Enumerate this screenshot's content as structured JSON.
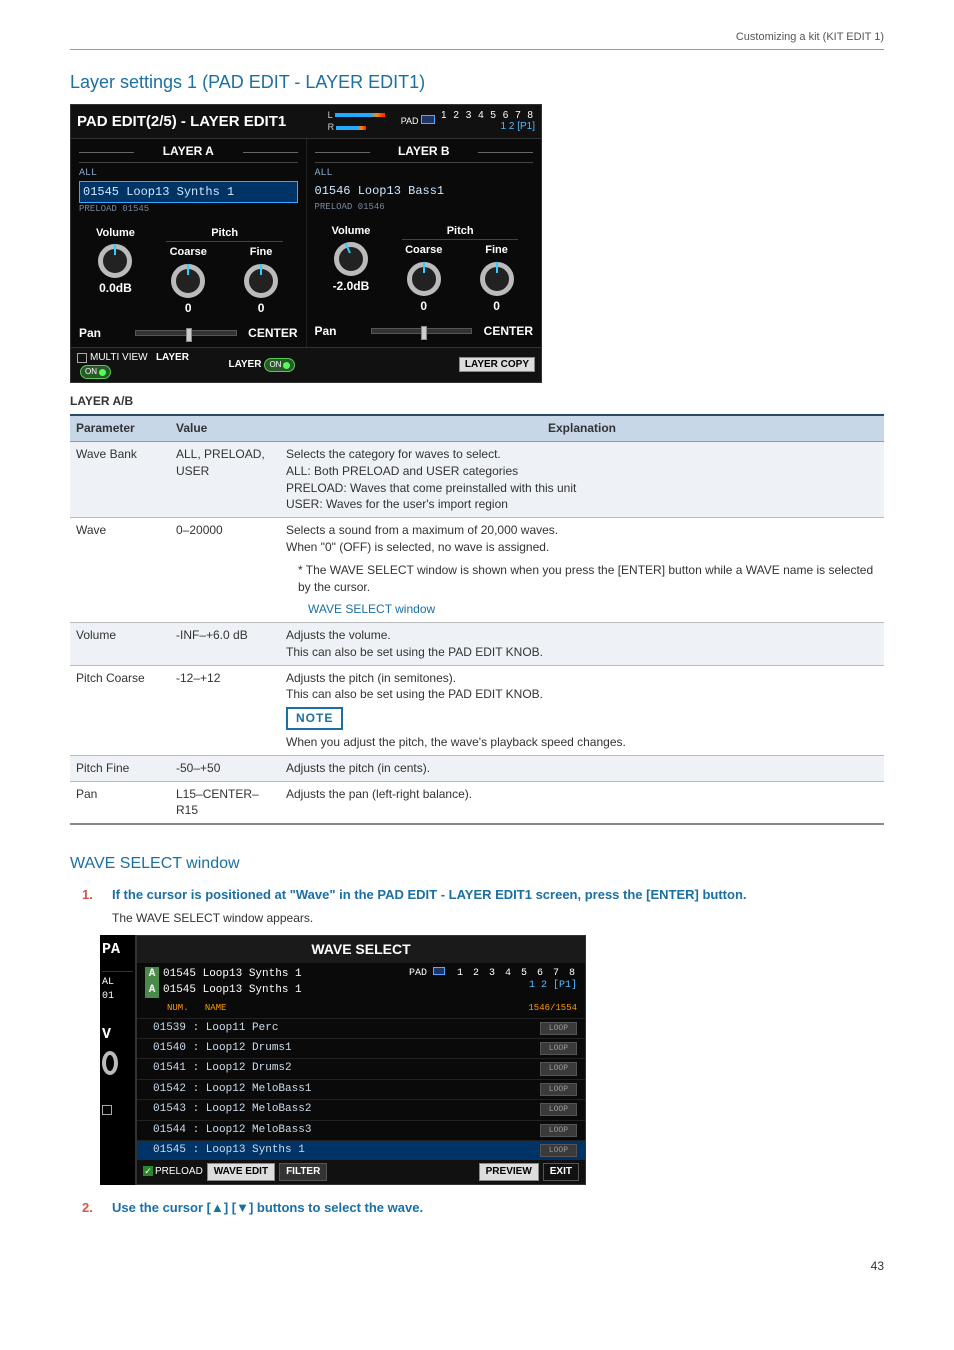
{
  "header": {
    "breadcrumb": "Customizing a kit (KIT EDIT 1)"
  },
  "section1_title": "Layer settings 1 (PAD EDIT - LAYER EDIT1)",
  "pad_edit_screen": {
    "title": "PAD EDIT(2/5) - LAYER EDIT1",
    "meters": {
      "L": "L",
      "R": "R"
    },
    "pad_label": "PAD",
    "pad_numbers": "1 2 3 4 5 6 7 8",
    "pad_sub": "1 2 [P1]",
    "layer_a": {
      "title": "LAYER A",
      "bank": "ALL",
      "wave": "01545 Loop13 Synths 1",
      "preload": "PRELOAD 01545",
      "volume_label": "Volume",
      "volume_val": "0.0dB",
      "pitch_label": "Pitch",
      "coarse_label": "Coarse",
      "coarse_val": "0",
      "fine_label": "Fine",
      "fine_val": "0",
      "pan_label": "Pan",
      "pan_val": "CENTER",
      "layer_on": "ON"
    },
    "layer_b": {
      "title": "LAYER B",
      "bank": "ALL",
      "wave": "01546 Loop13 Bass1",
      "preload": "PRELOAD 01546",
      "volume_label": "Volume",
      "volume_val": "-2.0dB",
      "pitch_label": "Pitch",
      "coarse_label": "Coarse",
      "coarse_val": "0",
      "fine_label": "Fine",
      "fine_val": "0",
      "pan_label": "Pan",
      "pan_val": "CENTER",
      "layer_on": "ON"
    },
    "footer": {
      "multi_view": "MULTI VIEW",
      "layer": "LAYER",
      "layer_copy": "LAYER COPY"
    }
  },
  "layer_ab_heading": "LAYER A/B",
  "table": {
    "headers": {
      "param": "Parameter",
      "value": "Value",
      "expl": "Explanation"
    },
    "rows": [
      {
        "param": "Wave Bank",
        "value": "ALL, PRELOAD, USER",
        "expl_lines": [
          "Selects the category for waves to select.",
          "ALL: Both PRELOAD and USER categories",
          "PRELOAD: Waves that come preinstalled with this unit",
          "USER: Waves for the user's import region"
        ]
      },
      {
        "param": "Wave",
        "value": "0–20000",
        "expl_lines": [
          "Selects a sound from a maximum of 20,000 waves.",
          "When \"0\" (OFF) is selected, no wave is assigned."
        ],
        "bullet": "The WAVE SELECT window is shown when you press the [ENTER] button while a WAVE name is selected by the cursor.",
        "link": "WAVE SELECT window"
      },
      {
        "param": "Volume",
        "value": "-INF–+6.0 dB",
        "expl_lines": [
          "Adjusts the volume.",
          "This can also be set using the PAD EDIT KNOB."
        ]
      },
      {
        "param": "Pitch Coarse",
        "value": "-12–+12",
        "expl_lines": [
          "Adjusts the pitch (in semitones).",
          "This can also be set using the PAD EDIT KNOB."
        ],
        "note": "NOTE",
        "after_note": "When you adjust the pitch, the wave's playback speed changes."
      },
      {
        "param": "Pitch Fine",
        "value": "-50–+50",
        "expl_lines": [
          "Adjusts the pitch (in cents)."
        ]
      },
      {
        "param": "Pan",
        "value": "L15–CENTER–R15",
        "expl_lines": [
          "Adjusts the pan (left-right balance)."
        ]
      }
    ]
  },
  "section2_title": "WAVE SELECT window",
  "steps": {
    "s1": {
      "num": "1.",
      "txt": "If the cursor is positioned at \"Wave\" in the PAD EDIT - LAYER EDIT1 screen, press the [ENTER] button.",
      "note": "The WAVE SELECT window appears."
    },
    "s2": {
      "num": "2.",
      "txt": "Use the cursor [▲] [▼] buttons to select the wave."
    }
  },
  "wave_select_screen": {
    "left_col": {
      "pa": "PA",
      "al": "AL",
      "n01": "01",
      "v": "V",
      "knob": ""
    },
    "title": "WAVE SELECT",
    "header_a1": "01545 Loop13 Synths 1",
    "header_a2": "01545 Loop13 Synths 1",
    "pad_label": "PAD",
    "pad_numbers": "1 2 3 4 5 6 7 8",
    "pad_sub": "1 2 [P1]",
    "col_num": "NUM.",
    "col_name": "NAME",
    "count": "1546/1554",
    "items": [
      {
        "name": "01539 : Loop11 Perc",
        "loop": "LOOP"
      },
      {
        "name": "01540 : Loop12 Drums1",
        "loop": "LOOP"
      },
      {
        "name": "01541 : Loop12 Drums2",
        "loop": "LOOP"
      },
      {
        "name": "01542 : Loop12 MeloBass1",
        "loop": "LOOP"
      },
      {
        "name": "01543 : Loop12 MeloBass2",
        "loop": "LOOP"
      },
      {
        "name": "01544 : Loop12 MeloBass3",
        "loop": "LOOP"
      },
      {
        "name": "01545 : Loop13 Synths 1",
        "loop": "LOOP",
        "selected": true
      }
    ],
    "footer": {
      "preload": "PRELOAD",
      "wave_edit": "WAVE EDIT",
      "filter": "FILTER",
      "preview": "PREVIEW",
      "exit": "EXIT"
    }
  },
  "page_number": "43"
}
